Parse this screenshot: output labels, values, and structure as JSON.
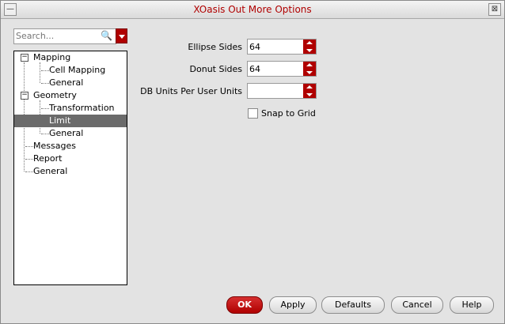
{
  "window": {
    "title": "XOasis Out More Options",
    "minimize_glyph": "—",
    "close_glyph": "⊠"
  },
  "search": {
    "placeholder": "Search...",
    "icon": "magnifier-icon"
  },
  "tree": {
    "items": [
      {
        "label": "Mapping",
        "level": 0,
        "toggle": "−"
      },
      {
        "label": "Cell Mapping",
        "level": 1
      },
      {
        "label": "General",
        "level": 1
      },
      {
        "label": "Geometry",
        "level": 0,
        "toggle": "−"
      },
      {
        "label": "Transformation",
        "level": 1
      },
      {
        "label": "Limit",
        "level": 1,
        "selected": true
      },
      {
        "label": "General",
        "level": 1
      },
      {
        "label": "Messages",
        "level": 0
      },
      {
        "label": "Report",
        "level": 0
      },
      {
        "label": "General",
        "level": 0
      }
    ]
  },
  "form": {
    "ellipse_sides": {
      "label": "Ellipse Sides",
      "value": "64"
    },
    "donut_sides": {
      "label": "Donut Sides",
      "value": "64"
    },
    "db_units": {
      "label": "DB Units Per User Units",
      "value": ""
    },
    "snap_to_grid": {
      "label": "Snap to Grid",
      "checked": false
    }
  },
  "buttons": {
    "ok": "OK",
    "apply": "Apply",
    "defaults": "Defaults",
    "cancel": "Cancel",
    "help": "Help"
  },
  "colors": {
    "accent": "#b00000",
    "selection": "#6b6b6b"
  }
}
